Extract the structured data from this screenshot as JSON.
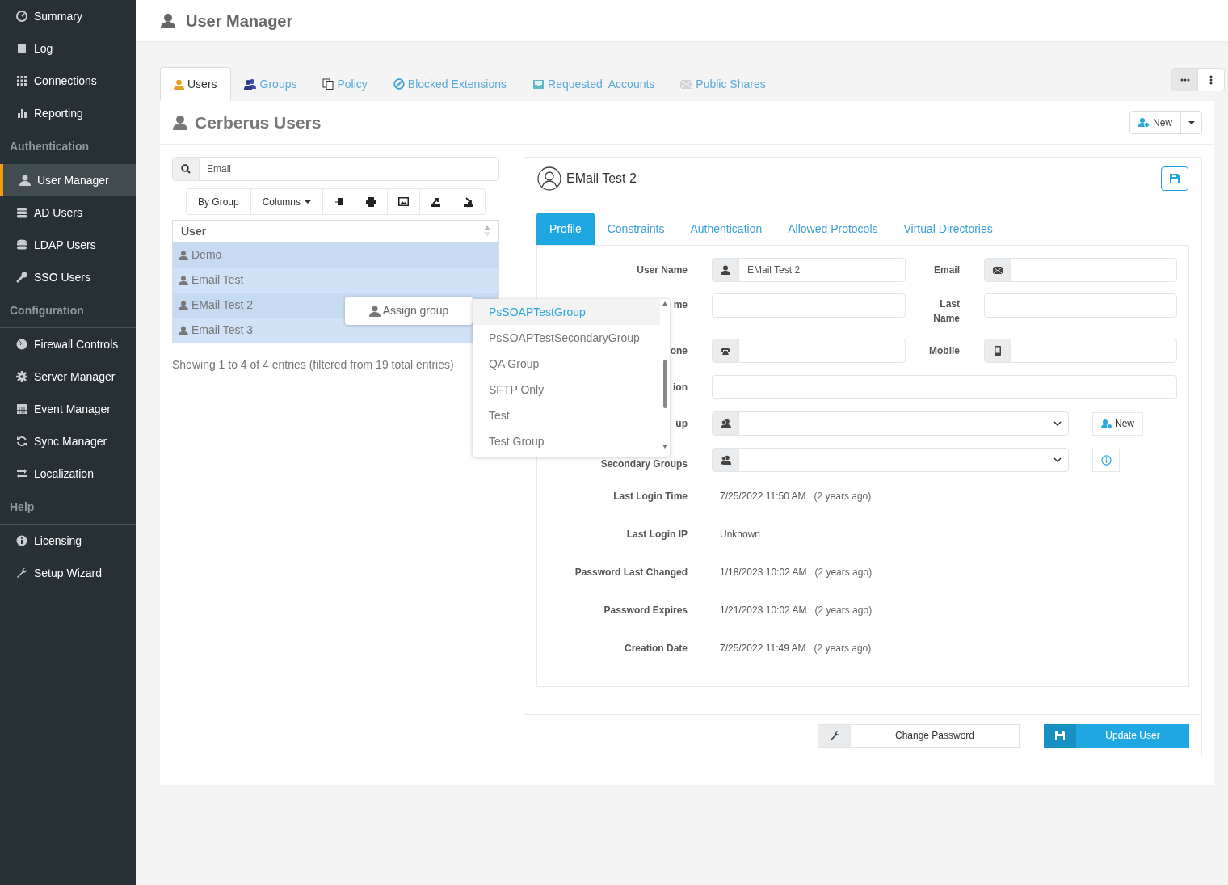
{
  "sidebar": {
    "items": [
      {
        "kind": "item",
        "label": "Summary",
        "selected": false
      },
      {
        "kind": "item",
        "label": "Log",
        "selected": false
      },
      {
        "kind": "item",
        "label": "Connections",
        "selected": false
      },
      {
        "kind": "item",
        "label": "Reporting",
        "selected": false
      },
      {
        "kind": "heading",
        "label": "Authentication"
      },
      {
        "kind": "item",
        "label": "User Manager",
        "selected": true
      },
      {
        "kind": "item",
        "label": "AD Users",
        "selected": false
      },
      {
        "kind": "item",
        "label": "LDAP Users",
        "selected": false
      },
      {
        "kind": "item",
        "label": "SSO Users",
        "selected": false
      },
      {
        "kind": "heading",
        "label": "Configuration"
      },
      {
        "kind": "item",
        "label": "Firewall Controls",
        "selected": false
      },
      {
        "kind": "item",
        "label": "Server Manager",
        "selected": false
      },
      {
        "kind": "item",
        "label": "Event Manager",
        "selected": false
      },
      {
        "kind": "item",
        "label": "Sync Manager",
        "selected": false
      },
      {
        "kind": "item",
        "label": "Localization",
        "selected": false
      },
      {
        "kind": "heading",
        "label": "Help"
      },
      {
        "kind": "item",
        "label": "Licensing",
        "selected": false
      },
      {
        "kind": "item",
        "label": "Setup Wizard",
        "selected": false
      }
    ]
  },
  "header": {
    "title": "User Manager"
  },
  "tabs": [
    {
      "label": "Users",
      "selected": true
    },
    {
      "label": "Groups",
      "selected": false
    },
    {
      "label": "Policy",
      "selected": false
    },
    {
      "label": "Blocked Extensions",
      "selected": false
    },
    {
      "label": "Requested  Accounts",
      "selected": false
    },
    {
      "label": "Public Shares",
      "selected": false
    }
  ],
  "panel": {
    "title": "Cerberus Users",
    "new_button": "New"
  },
  "search": {
    "value": "Email"
  },
  "table_tools": {
    "by_group": "By Group",
    "columns": "Columns"
  },
  "table": {
    "column": "User",
    "rows": [
      {
        "name": "Demo",
        "selected": true
      },
      {
        "name": "Email Test",
        "selected": true
      },
      {
        "name": "EMail Test 2",
        "selected": true
      },
      {
        "name": "Email Test 3",
        "selected": true
      }
    ]
  },
  "table_info": "Showing 1 to 4 of 4 entries (filtered from 19 total entries)",
  "context_menu": {
    "button": "Assign group",
    "options": [
      {
        "label": "PsSOAPTestGroup",
        "selected": true
      },
      {
        "label": "PsSOAPTestSecondaryGroup",
        "selected": false
      },
      {
        "label": "QA Group",
        "selected": false
      },
      {
        "label": "SFTP Only",
        "selected": false
      },
      {
        "label": "Test",
        "selected": false
      },
      {
        "label": "Test Group",
        "selected": false
      }
    ]
  },
  "detail": {
    "title": "EMail Test 2",
    "tabs": [
      {
        "label": "Profile",
        "selected": true
      },
      {
        "label": "Constraints",
        "selected": false
      },
      {
        "label": "Authentication",
        "selected": false
      },
      {
        "label": "Allowed Protocols",
        "selected": false
      },
      {
        "label": "Virtual Directories",
        "selected": false
      }
    ],
    "form": {
      "user_name_label": "User Name",
      "user_name_value": "EMail Test 2",
      "email_label": "Email",
      "label_2": "me",
      "last_name_label": "Last Name",
      "label_3": "one",
      "mobile_label": "Mobile",
      "label_4": "ion",
      "label_5": "up",
      "secondary_groups_label": "Secondary Groups",
      "new_button": "New"
    },
    "info": [
      {
        "label": "Last Login Time",
        "value": "7/25/2022 11:50 AM",
        "ago": "(2 years ago)"
      },
      {
        "label": "Last Login IP",
        "value": "Unknown"
      },
      {
        "label": "Password Last Changed",
        "value": "1/18/2023 10:02 AM",
        "ago": "(2 years ago)"
      },
      {
        "label": "Password Expires",
        "value": "1/21/2023 10:02 AM",
        "ago": "(2 years ago)"
      },
      {
        "label": "Creation Date",
        "value": "7/25/2022 11:49 AM",
        "ago": "(2 years ago)"
      }
    ],
    "change_password": "Change Password",
    "update_button": "Update User"
  }
}
